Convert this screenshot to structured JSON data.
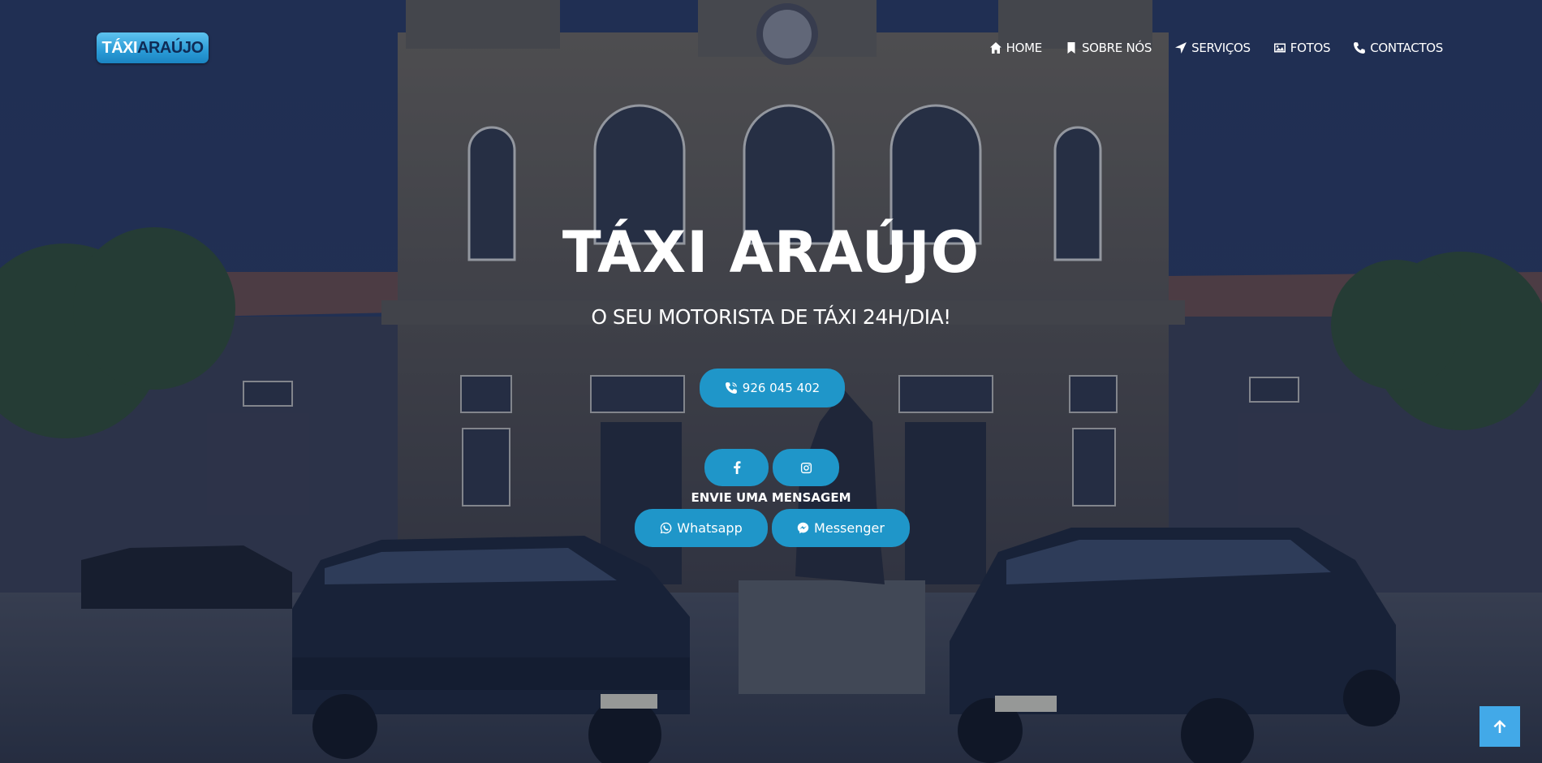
{
  "brand": {
    "logo_part1": "TÁXI",
    "logo_part2": "ARAÚJO"
  },
  "nav": [
    {
      "label": "HOME",
      "icon": "home-icon"
    },
    {
      "label": "SOBRE NÓS",
      "icon": "bookmark-icon"
    },
    {
      "label": "SERVIÇOS",
      "icon": "location-arrow-icon"
    },
    {
      "label": "FOTOS",
      "icon": "image-icon"
    },
    {
      "label": "CONTACTOS",
      "icon": "phone-icon"
    }
  ],
  "hero": {
    "title": "TÁXI ARAÚJO",
    "subtitle": "O SEU MOTORISTA DE TÁXI 24H/DIA!",
    "phone_label": "926 045 402",
    "send_message_label": "ENVIE UMA MENSAGEM",
    "whatsapp_label": "Whatsapp",
    "messenger_label": "Messenger"
  },
  "social": [
    {
      "name": "facebook",
      "icon": "facebook-icon"
    },
    {
      "name": "instagram",
      "icon": "instagram-icon"
    }
  ],
  "scroll_top": {
    "icon": "arrow-up-icon"
  },
  "colors": {
    "accent": "#1f96c9",
    "scroll_top": "#42a9e8",
    "overlay": "#152142",
    "logo_dark": "#0f2b55"
  }
}
